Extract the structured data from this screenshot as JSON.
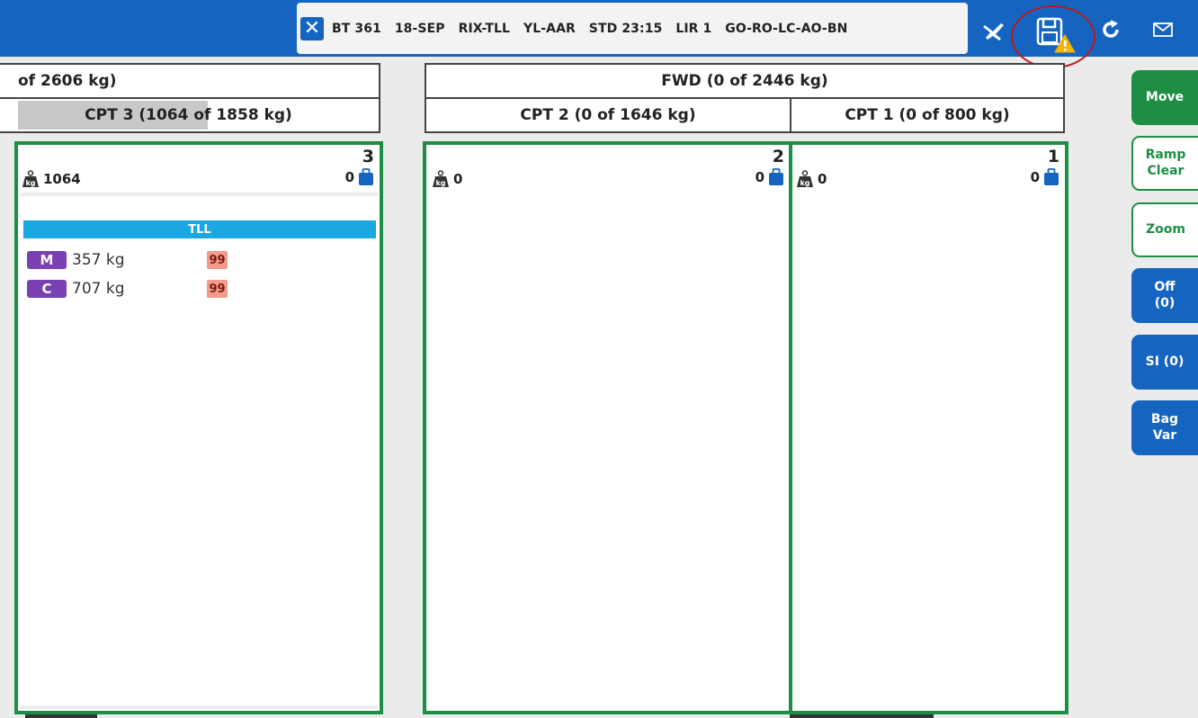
{
  "header": {
    "flight_info": "BT 361   18-SEP   RIX-TLL   YL-AAR   STD 23:15   LIR 1   GO-RO-LC-AO-BN"
  },
  "icons": {
    "close": "close-icon",
    "aircraft": "aircraft-icon",
    "save": "save-warning-icon",
    "refresh": "refresh-icon",
    "mail": "mail-icon"
  },
  "holds": {
    "aft_header": "of 2606 kg)",
    "fwd_header": "FWD (0 of 2446 kg)",
    "cpt3_header": "CPT 3 (1064 of 1858 kg)",
    "cpt3_fill": 0.573,
    "cpt2_header": "CPT 2 (0 of 1646 kg)",
    "cpt1_header": "CPT 1 (0 of 800 kg)"
  },
  "compartments": [
    {
      "number": "3",
      "weight": "1064",
      "bags": "0",
      "destination": "TLL",
      "loads": [
        {
          "type": "M",
          "weight": "357 kg",
          "pieces": "99"
        },
        {
          "type": "C",
          "weight": "707 kg",
          "pieces": "99"
        }
      ]
    },
    {
      "number": "2",
      "weight": "0",
      "bags": "0"
    },
    {
      "number": "1",
      "weight": "0",
      "bags": "0"
    }
  ],
  "side_buttons": {
    "move": "Move",
    "ramp_clear": "Ramp\nClear",
    "zoom": "Zoom",
    "off": "Off\n(0)",
    "si": "SI (0)",
    "bag_var": "Bag\nVar"
  },
  "colors": {
    "topbar": "#1565c0",
    "compartment_border": "#1e8e45",
    "destination_bar": "#1ba8e0",
    "load_badge": "#7a3fb0",
    "pieces_badge": "#f29a8b",
    "warning": "#f5b400",
    "highlight_circle": "#b71c1c"
  }
}
